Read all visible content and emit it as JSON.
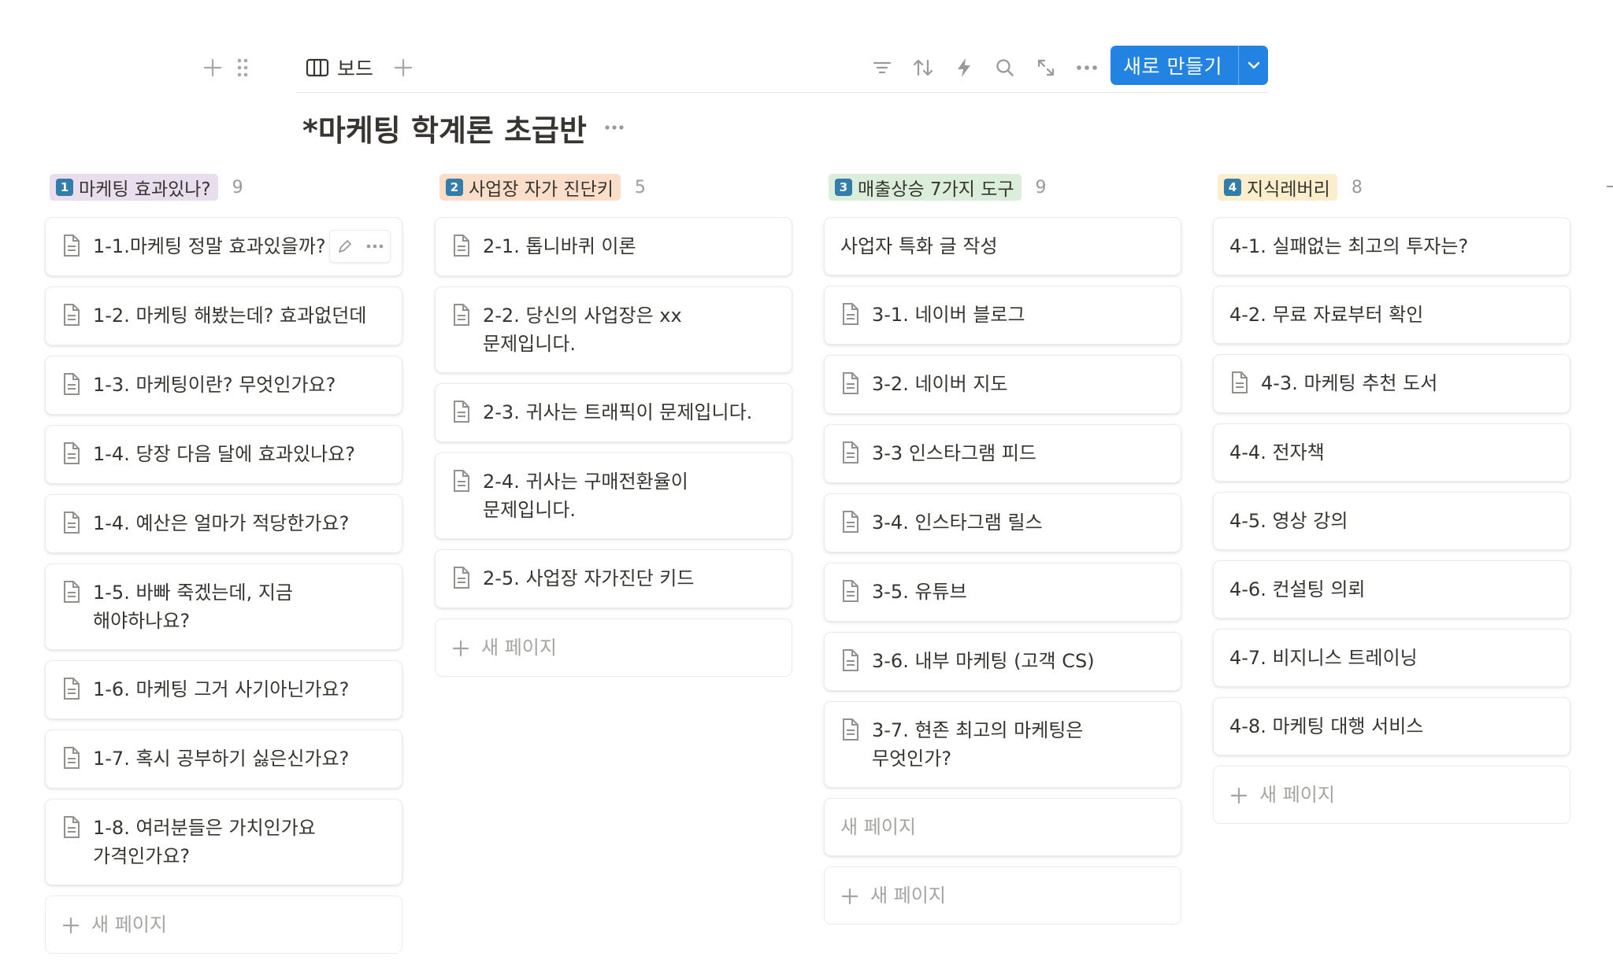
{
  "toolbar": {
    "view_label": "보드",
    "new_button_label": "새로 만들기"
  },
  "page": {
    "title": "*마케팅 학계론 초급반"
  },
  "colors": {
    "accent": "#2383e2",
    "tag_purple": "#e8deee",
    "tag_orange": "#fadec9",
    "tag_green": "#dbeddb",
    "tag_yellow": "#fbeecd",
    "badge": "#337ea9"
  },
  "columns": [
    {
      "badge": "1",
      "label": "마케팅 효과있나?",
      "count": "9",
      "cards": [
        "1-1.마케팅 정말 효과있을까?",
        "1-2. 마케팅 해봤는데? 효과없던데",
        "1-3. 마케팅이란? 무엇인가요?",
        "1-4. 당장 다음 달에 효과있나요?",
        "1-4. 예산은 얼마가 적당한가요?",
        "1-5. 바빠 죽겠는데, 지금 해야하나요?",
        "1-6. 마케팅 그거 사기아닌가요?",
        "1-7. 혹시 공부하기 싫은신가요?",
        "1-8. 여러분들은 가치인가요 가격인가요?"
      ],
      "new_page": "새 페이지"
    },
    {
      "badge": "2",
      "label": "사업장 자가 진단키",
      "count": "5",
      "cards": [
        "2-1. 톱니바퀴 이론",
        "2-2. 당신의 사업장은 xx 문제입니다.",
        "2-3. 귀사는 트래픽이 문제입니다.",
        "2-4. 귀사는 구매전환율이 문제입니다.",
        "2-5. 사업장 자가진단 키드"
      ],
      "new_page": "새 페이지"
    },
    {
      "badge": "3",
      "label": "매출상승 7가지 도구",
      "count": "9",
      "first_card": "사업자 특화 글 작성",
      "cards": [
        "3-1. 네이버 블로그",
        "3-2. 네이버 지도",
        "3-3 인스타그램 피드",
        "3-4. 인스타그램 릴스",
        "3-5. 유튜브",
        "3-6. 내부 마케팅 (고객 CS)",
        "3-7. 현존 최고의 마케팅은 무엇인가?"
      ],
      "untitled_card": "새 페이지",
      "new_page": "새 페이지"
    },
    {
      "badge": "4",
      "label": "지식레버리",
      "count": "8",
      "cards": [
        "4-1. 실패없는 최고의 투자는?",
        "4-2. 무료 자료부터 확인",
        "4-3. 마케팅 추천 도서",
        "4-4. 전자책",
        "4-5. 영상 강의",
        "4-6. 컨설팅 의뢰",
        "4-7. 비지니스 트레이닝",
        "4-8. 마케팅 대행 서비스"
      ],
      "new_page": "새 페이지"
    }
  ]
}
